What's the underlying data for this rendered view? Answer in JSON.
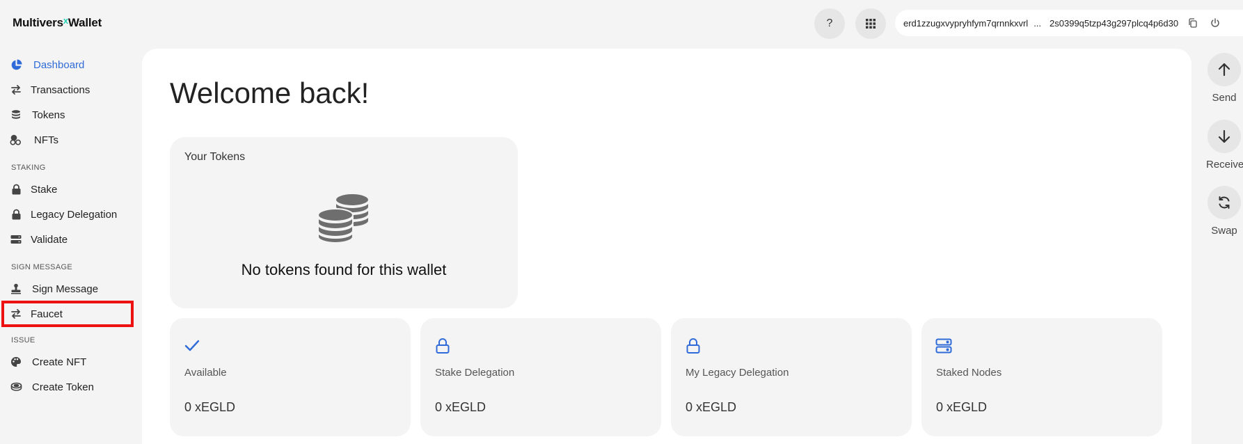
{
  "header": {
    "logo_part1": "Multivers",
    "logo_x": "x",
    "logo_part2": "Wallet",
    "help_label": "?",
    "address_start": "erd1zzugxvypryhfym7qrnnkxvrl",
    "address_ellipsis": "...",
    "address_end": "2s0399q5tzp43g297plcq4p6d30"
  },
  "sidebar": {
    "items": [
      {
        "label": "Dashboard",
        "icon": "pie-chart-icon",
        "active": true
      },
      {
        "label": "Transactions",
        "icon": "arrows-swap-icon"
      },
      {
        "label": "Tokens",
        "icon": "coins-icon"
      },
      {
        "label": "NFTs",
        "icon": "cubes-icon"
      }
    ],
    "staking_label": "STAKING",
    "staking_items": [
      {
        "label": "Stake",
        "icon": "lock-icon"
      },
      {
        "label": "Legacy Delegation",
        "icon": "lock-icon"
      },
      {
        "label": "Validate",
        "icon": "server-icon"
      }
    ],
    "sign_label": "SIGN MESSAGE",
    "sign_items": [
      {
        "label": "Sign Message",
        "icon": "stamp-icon"
      },
      {
        "label": "Faucet",
        "icon": "arrows-swap-icon"
      }
    ],
    "issue_label": "ISSUE",
    "issue_items": [
      {
        "label": "Create NFT",
        "icon": "palette-icon"
      },
      {
        "label": "Create Token",
        "icon": "coin-icon"
      }
    ]
  },
  "main": {
    "welcome": "Welcome back!",
    "tokens_card": {
      "title": "Your Tokens",
      "empty_message": "No tokens found for this wallet"
    },
    "stats": [
      {
        "label": "Available",
        "value": "0 xEGLD",
        "icon": "check-icon"
      },
      {
        "label": "Stake Delegation",
        "value": "0 xEGLD",
        "icon": "lock-icon"
      },
      {
        "label": "My Legacy Delegation",
        "value": "0 xEGLD",
        "icon": "lock-icon"
      },
      {
        "label": "Staked Nodes",
        "value": "0 xEGLD",
        "icon": "server-icon"
      }
    ]
  },
  "actions": [
    {
      "label": "Send",
      "icon": "arrow-up-icon"
    },
    {
      "label": "Receive",
      "icon": "arrow-down-icon"
    },
    {
      "label": "Swap",
      "icon": "refresh-icon"
    }
  ],
  "colors": {
    "accent": "#2f6bd8",
    "highlight": "#ee1111",
    "logo_x": "#23d0b0"
  }
}
